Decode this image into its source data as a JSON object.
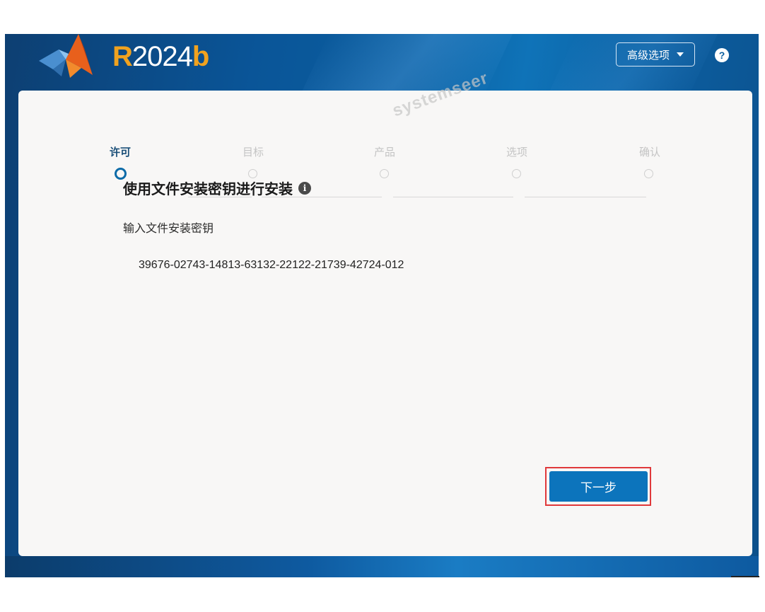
{
  "header": {
    "version_r": "R",
    "version_num": "2024",
    "version_b": "b",
    "advanced_options_label": "高级选项",
    "help_label": "?"
  },
  "watermark": "systemseer",
  "steps": [
    {
      "label": "许可",
      "active": true
    },
    {
      "label": "目标",
      "active": false
    },
    {
      "label": "产品",
      "active": false
    },
    {
      "label": "选项",
      "active": false
    },
    {
      "label": "确认",
      "active": false
    }
  ],
  "main": {
    "heading": "使用文件安装密钥进行安装",
    "info_icon": "i",
    "subheading": "输入文件安装密钥",
    "install_key_value": "39676-02743-14813-63132-22122-21739-42724-012"
  },
  "footer": {
    "next_label": "下一步"
  },
  "colors": {
    "accent": "#0c74bc",
    "brand_orange": "#f0a21f",
    "highlight_red": "#e0393b"
  }
}
